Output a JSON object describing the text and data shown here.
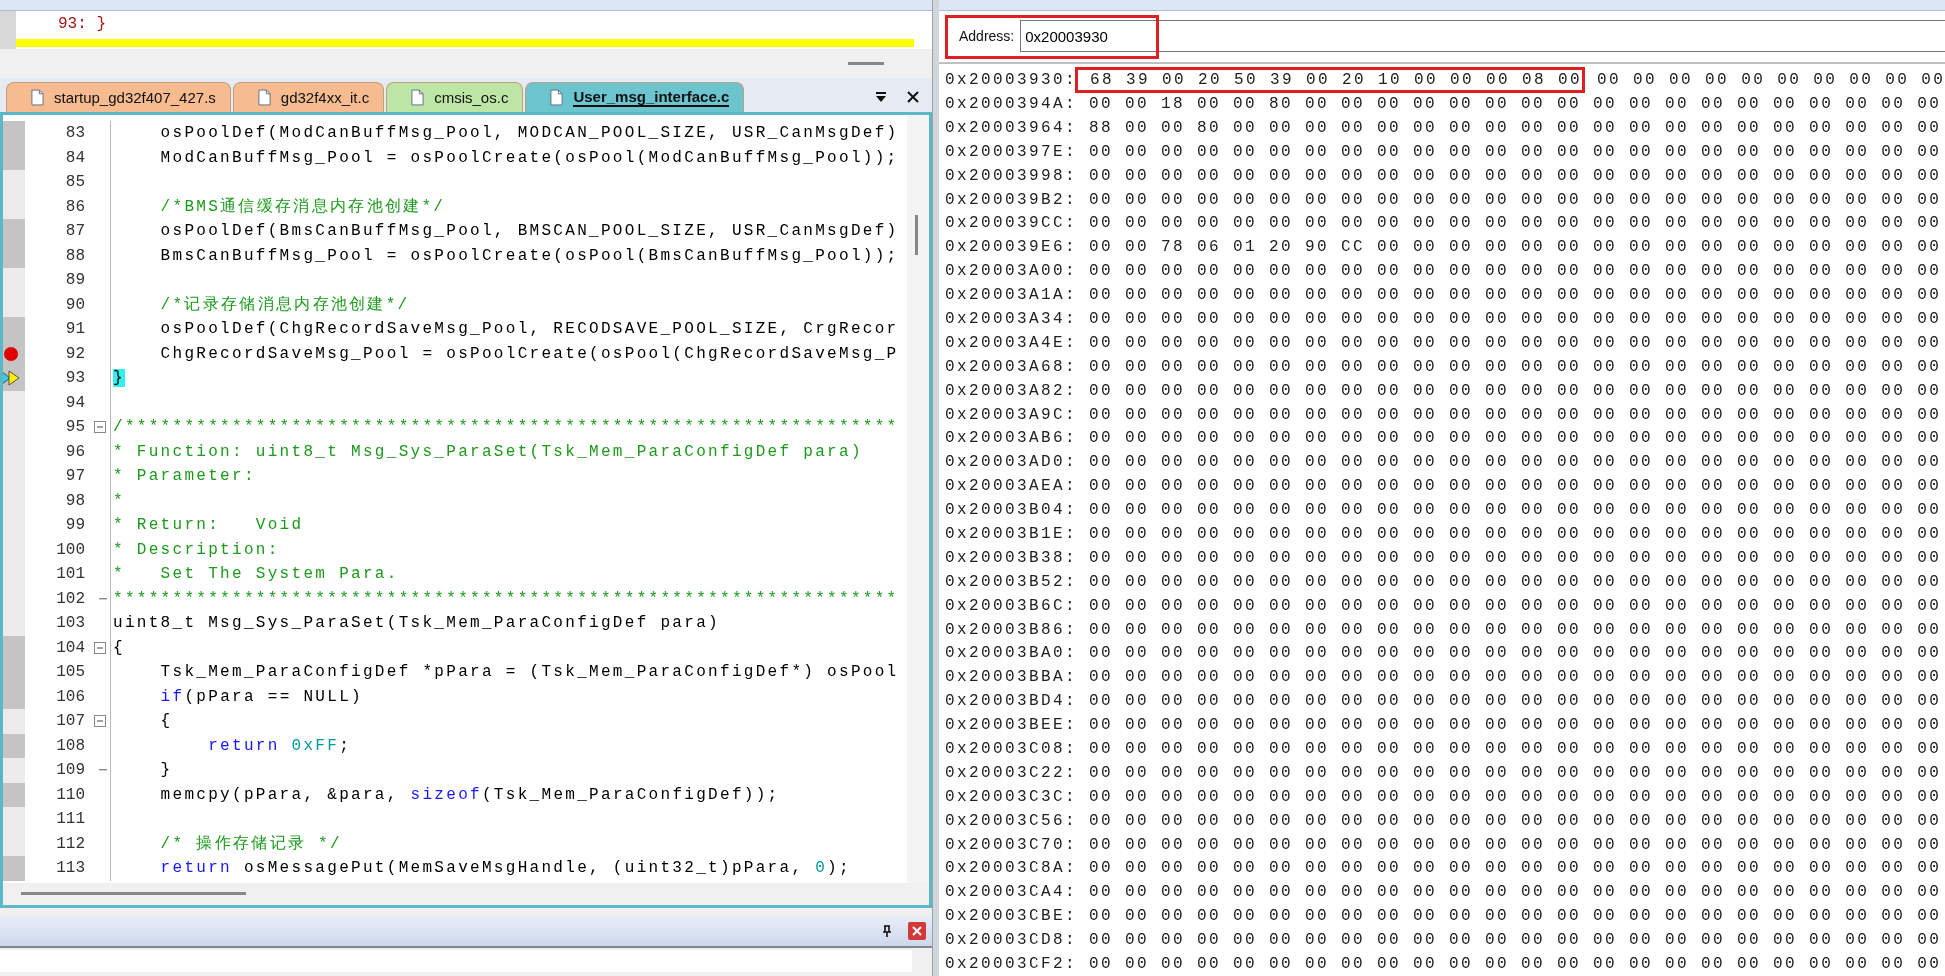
{
  "disassembly": {
    "line": "93: }",
    "current_line": true
  },
  "editor": {
    "tabs": [
      {
        "label": "startup_gd32f407_427.s",
        "selected": false,
        "color": "#f6bb8e"
      },
      {
        "label": "gd32f4xx_it.c",
        "selected": false,
        "color": "#f6bb8e"
      },
      {
        "label": "cmsis_os.c",
        "selected": false,
        "color": "#bde6a4"
      },
      {
        "label": "User_msg_interface.c",
        "selected": true,
        "color": "#6cc4cf"
      }
    ],
    "lines": [
      {
        "number": "83",
        "executable": true,
        "segments": [
          {
            "kind": "plain",
            "text": "    osPoolDef(ModCanBuffMsg_Pool, MODCAN_POOL_SIZE, USR_CanMsgDef)"
          }
        ]
      },
      {
        "number": "84",
        "executable": true,
        "segments": [
          {
            "kind": "plain",
            "text": "    ModCanBuffMsg_Pool = osPoolCreate(osPool(ModCanBuffMsg_Pool));"
          }
        ]
      },
      {
        "number": "85",
        "executable": false
      },
      {
        "number": "86",
        "executable": false,
        "segments": [
          {
            "kind": "comment",
            "text": "    /*BMS通信缓存消息内存池创建*/"
          }
        ]
      },
      {
        "number": "87",
        "executable": true,
        "segments": [
          {
            "kind": "plain",
            "text": "    osPoolDef(BmsCanBuffMsg_Pool, BMSCAN_POOL_SIZE, USR_CanMsgDef)"
          }
        ]
      },
      {
        "number": "88",
        "executable": true,
        "segments": [
          {
            "kind": "plain",
            "text": "    BmsCanBuffMsg_Pool = osPoolCreate(osPool(BmsCanBuffMsg_Pool));"
          }
        ]
      },
      {
        "number": "89",
        "executable": false
      },
      {
        "number": "90",
        "executable": false,
        "segments": [
          {
            "kind": "comment",
            "text": "    /*记录存储消息内存池创建*/"
          }
        ]
      },
      {
        "number": "91",
        "executable": true,
        "segments": [
          {
            "kind": "plain",
            "text": "    osPoolDef(ChgRecordSaveMsg_Pool, RECODSAVE_POOL_SIZE, CrgRecor"
          }
        ]
      },
      {
        "number": "92",
        "executable": true,
        "breakpoint": true,
        "segments": [
          {
            "kind": "plain",
            "text": "    ChgRecordSaveMsg_Pool = osPoolCreate(osPool(ChgRecordSaveMsg_P"
          }
        ]
      },
      {
        "number": "93",
        "executable": true,
        "current": true,
        "segments": [
          {
            "kind": "match",
            "text": "}"
          }
        ]
      },
      {
        "number": "94",
        "executable": false
      },
      {
        "number": "95",
        "executable": false,
        "fold_start": true,
        "segments": [
          {
            "kind": "comment",
            "text": "/*****************************************************************"
          }
        ]
      },
      {
        "number": "96",
        "executable": false,
        "segments": [
          {
            "kind": "comment",
            "text": "* Function: uint8_t Msg_Sys_ParaSet(Tsk_Mem_ParaConfigDef para)"
          }
        ]
      },
      {
        "number": "97",
        "executable": false,
        "segments": [
          {
            "kind": "comment",
            "text": "* Parameter:"
          }
        ]
      },
      {
        "number": "98",
        "executable": false,
        "segments": [
          {
            "kind": "comment",
            "text": "*"
          }
        ]
      },
      {
        "number": "99",
        "executable": false,
        "segments": [
          {
            "kind": "comment",
            "text": "* Return:   Void"
          }
        ]
      },
      {
        "number": "100",
        "executable": false,
        "segments": [
          {
            "kind": "comment",
            "text": "* Description:"
          }
        ]
      },
      {
        "number": "101",
        "executable": false,
        "segments": [
          {
            "kind": "comment",
            "text": "*   Set The System Para."
          }
        ]
      },
      {
        "number": "102",
        "executable": false,
        "fold_end": true,
        "segments": [
          {
            "kind": "comment",
            "text": "******************************************************************"
          }
        ]
      },
      {
        "number": "103",
        "executable": false,
        "segments": [
          {
            "kind": "plain",
            "text": "uint8_t Msg_Sys_ParaSet(Tsk_Mem_ParaConfigDef para)"
          }
        ]
      },
      {
        "number": "104",
        "executable": true,
        "fold_start": true,
        "segments": [
          {
            "kind": "plain",
            "text": "{"
          }
        ]
      },
      {
        "number": "105",
        "executable": true,
        "segments": [
          {
            "kind": "plain",
            "text": "    Tsk_Mem_ParaConfigDef *pPara = (Tsk_Mem_ParaConfigDef*) osPool"
          }
        ]
      },
      {
        "number": "106",
        "executable": true,
        "segments": [
          {
            "kind": "keyword",
            "text": "    if"
          },
          {
            "kind": "plain",
            "text": "(pPara == NULL)"
          }
        ]
      },
      {
        "number": "107",
        "executable": false,
        "fold_start": true,
        "segments": [
          {
            "kind": "plain",
            "text": "    {"
          }
        ]
      },
      {
        "number": "108",
        "executable": true,
        "segments": [
          {
            "kind": "keyword",
            "text": "        return "
          },
          {
            "kind": "number",
            "text": "0xFF"
          },
          {
            "kind": "plain",
            "text": ";"
          }
        ]
      },
      {
        "number": "109",
        "executable": false,
        "fold_end": true,
        "segments": [
          {
            "kind": "plain",
            "text": "    }"
          }
        ]
      },
      {
        "number": "110",
        "executable": true,
        "segments": [
          {
            "kind": "plain",
            "text": "    memcpy(pPara, &para, "
          },
          {
            "kind": "keyword",
            "text": "sizeof"
          },
          {
            "kind": "plain",
            "text": "(Tsk_Mem_ParaConfigDef));"
          }
        ]
      },
      {
        "number": "111",
        "executable": false
      },
      {
        "number": "112",
        "executable": false,
        "segments": [
          {
            "kind": "comment",
            "text": "    /* 操作存储记录 */"
          }
        ]
      },
      {
        "number": "113",
        "executable": true,
        "segments": [
          {
            "kind": "keyword",
            "text": "    return"
          },
          {
            "kind": "plain",
            "text": " osMessagePut(MemSaveMsgHandle, (uint32_t)pPara, "
          },
          {
            "kind": "number",
            "text": "0"
          },
          {
            "kind": "plain",
            "text": ");"
          }
        ]
      }
    ]
  },
  "memory": {
    "address": {
      "label": "Address:",
      "value": "0x20003930",
      "marked": true
    },
    "rows": [
      {
        "address": "0x20003930:",
        "bytes": [
          {
            "text": "68 39 00 20 50 39 00 20 10 00 00 00 08 00",
            "marked": true
          },
          {
            "text": "00 00 00 00 00 00 00 00 00 00",
            "marked": false
          }
        ]
      },
      {
        "address": "0x2000394A:",
        "bytes": [
          {
            "text": "00 00 18 00 00 80 00 00 00 00 00 00 00 00 00 00 00 00 00 00 00 00 00 00",
            "marked": false
          }
        ]
      },
      {
        "address": "0x20003964:",
        "bytes": [
          {
            "text": "88 00 00 80 00 00 00 00 00 00 00 00 00 00 00 00 00 00 00 00 00 00 00 00",
            "marked": false
          }
        ]
      },
      {
        "address": "0x2000397E:",
        "bytes": [
          {
            "text": "00 00 00 00 00 00 00 00 00 00 00 00 00 00 00 00 00 00 00 00 00 00 00 00",
            "marked": false
          }
        ]
      },
      {
        "address": "0x20003998:",
        "bytes": [
          {
            "text": "00 00 00 00 00 00 00 00 00 00 00 00 00 00 00 00 00 00 00 00 00 00 00 00",
            "marked": false
          }
        ]
      },
      {
        "address": "0x200039B2:",
        "bytes": [
          {
            "text": "00 00 00 00 00 00 00 00 00 00 00 00 00 00 00 00 00 00 00 00 00 00 00 00",
            "marked": false
          }
        ]
      },
      {
        "address": "0x200039CC:",
        "bytes": [
          {
            "text": "00 00 00 00 00 00 00 00 00 00 00 00 00 00 00 00 00 00 00 00 00 00 00 00",
            "marked": false
          }
        ]
      },
      {
        "address": "0x200039E6:",
        "bytes": [
          {
            "text": "00 00 78 06 01 20 90 CC 00 00 00 00 00 00 00 00 00 00 00 00 00 00 00 00",
            "marked": false
          }
        ]
      },
      {
        "address": "0x20003A00:",
        "bytes": [
          {
            "text": "00 00 00 00 00 00 00 00 00 00 00 00 00 00 00 00 00 00 00 00 00 00 00 00",
            "marked": false
          }
        ]
      },
      {
        "address": "0x20003A1A:",
        "bytes": [
          {
            "text": "00 00 00 00 00 00 00 00 00 00 00 00 00 00 00 00 00 00 00 00 00 00 00 00",
            "marked": false
          }
        ]
      },
      {
        "address": "0x20003A34:",
        "bytes": [
          {
            "text": "00 00 00 00 00 00 00 00 00 00 00 00 00 00 00 00 00 00 00 00 00 00 00 00",
            "marked": false
          }
        ]
      },
      {
        "address": "0x20003A4E:",
        "bytes": [
          {
            "text": "00 00 00 00 00 00 00 00 00 00 00 00 00 00 00 00 00 00 00 00 00 00 00 00",
            "marked": false
          }
        ]
      },
      {
        "address": "0x20003A68:",
        "bytes": [
          {
            "text": "00 00 00 00 00 00 00 00 00 00 00 00 00 00 00 00 00 00 00 00 00 00 00 00",
            "marked": false
          }
        ]
      },
      {
        "address": "0x20003A82:",
        "bytes": [
          {
            "text": "00 00 00 00 00 00 00 00 00 00 00 00 00 00 00 00 00 00 00 00 00 00 00 00",
            "marked": false
          }
        ]
      },
      {
        "address": "0x20003A9C:",
        "bytes": [
          {
            "text": "00 00 00 00 00 00 00 00 00 00 00 00 00 00 00 00 00 00 00 00 00 00 00 00",
            "marked": false
          }
        ]
      },
      {
        "address": "0x20003AB6:",
        "bytes": [
          {
            "text": "00 00 00 00 00 00 00 00 00 00 00 00 00 00 00 00 00 00 00 00 00 00 00 00",
            "marked": false
          }
        ]
      },
      {
        "address": "0x20003AD0:",
        "bytes": [
          {
            "text": "00 00 00 00 00 00 00 00 00 00 00 00 00 00 00 00 00 00 00 00 00 00 00 00",
            "marked": false
          }
        ]
      },
      {
        "address": "0x20003AEA:",
        "bytes": [
          {
            "text": "00 00 00 00 00 00 00 00 00 00 00 00 00 00 00 00 00 00 00 00 00 00 00 00",
            "marked": false
          }
        ]
      },
      {
        "address": "0x20003B04:",
        "bytes": [
          {
            "text": "00 00 00 00 00 00 00 00 00 00 00 00 00 00 00 00 00 00 00 00 00 00 00 00",
            "marked": false
          }
        ]
      },
      {
        "address": "0x20003B1E:",
        "bytes": [
          {
            "text": "00 00 00 00 00 00 00 00 00 00 00 00 00 00 00 00 00 00 00 00 00 00 00 00",
            "marked": false
          }
        ]
      },
      {
        "address": "0x20003B38:",
        "bytes": [
          {
            "text": "00 00 00 00 00 00 00 00 00 00 00 00 00 00 00 00 00 00 00 00 00 00 00 00",
            "marked": false
          }
        ]
      },
      {
        "address": "0x20003B52:",
        "bytes": [
          {
            "text": "00 00 00 00 00 00 00 00 00 00 00 00 00 00 00 00 00 00 00 00 00 00 00 00",
            "marked": false
          }
        ]
      },
      {
        "address": "0x20003B6C:",
        "bytes": [
          {
            "text": "00 00 00 00 00 00 00 00 00 00 00 00 00 00 00 00 00 00 00 00 00 00 00 00",
            "marked": false
          }
        ]
      },
      {
        "address": "0x20003B86:",
        "bytes": [
          {
            "text": "00 00 00 00 00 00 00 00 00 00 00 00 00 00 00 00 00 00 00 00 00 00 00 00",
            "marked": false
          }
        ]
      },
      {
        "address": "0x20003BA0:",
        "bytes": [
          {
            "text": "00 00 00 00 00 00 00 00 00 00 00 00 00 00 00 00 00 00 00 00 00 00 00 00",
            "marked": false
          }
        ]
      },
      {
        "address": "0x20003BBA:",
        "bytes": [
          {
            "text": "00 00 00 00 00 00 00 00 00 00 00 00 00 00 00 00 00 00 00 00 00 00 00 00",
            "marked": false
          }
        ]
      },
      {
        "address": "0x20003BD4:",
        "bytes": [
          {
            "text": "00 00 00 00 00 00 00 00 00 00 00 00 00 00 00 00 00 00 00 00 00 00 00 00",
            "marked": false
          }
        ]
      },
      {
        "address": "0x20003BEE:",
        "bytes": [
          {
            "text": "00 00 00 00 00 00 00 00 00 00 00 00 00 00 00 00 00 00 00 00 00 00 00 00",
            "marked": false
          }
        ]
      },
      {
        "address": "0x20003C08:",
        "bytes": [
          {
            "text": "00 00 00 00 00 00 00 00 00 00 00 00 00 00 00 00 00 00 00 00 00 00 00 00",
            "marked": false
          }
        ]
      },
      {
        "address": "0x20003C22:",
        "bytes": [
          {
            "text": "00 00 00 00 00 00 00 00 00 00 00 00 00 00 00 00 00 00 00 00 00 00 00 00",
            "marked": false
          }
        ]
      },
      {
        "address": "0x20003C3C:",
        "bytes": [
          {
            "text": "00 00 00 00 00 00 00 00 00 00 00 00 00 00 00 00 00 00 00 00 00 00 00 00",
            "marked": false
          }
        ]
      },
      {
        "address": "0x20003C56:",
        "bytes": [
          {
            "text": "00 00 00 00 00 00 00 00 00 00 00 00 00 00 00 00 00 00 00 00 00 00 00 00",
            "marked": false
          }
        ]
      },
      {
        "address": "0x20003C70:",
        "bytes": [
          {
            "text": "00 00 00 00 00 00 00 00 00 00 00 00 00 00 00 00 00 00 00 00 00 00 00 00",
            "marked": false
          }
        ]
      },
      {
        "address": "0x20003C8A:",
        "bytes": [
          {
            "text": "00 00 00 00 00 00 00 00 00 00 00 00 00 00 00 00 00 00 00 00 00 00 00 00",
            "marked": false
          }
        ]
      },
      {
        "address": "0x20003CA4:",
        "bytes": [
          {
            "text": "00 00 00 00 00 00 00 00 00 00 00 00 00 00 00 00 00 00 00 00 00 00 00 00",
            "marked": false
          }
        ]
      },
      {
        "address": "0x20003CBE:",
        "bytes": [
          {
            "text": "00 00 00 00 00 00 00 00 00 00 00 00 00 00 00 00 00 00 00 00 00 00 00 00",
            "marked": false
          }
        ]
      },
      {
        "address": "0x20003CD8:",
        "bytes": [
          {
            "text": "00 00 00 00 00 00 00 00 00 00 00 00 00 00 00 00 00 00 00 00 00 00 00 00",
            "marked": false
          }
        ]
      },
      {
        "address": "0x20003CF2:",
        "bytes": [
          {
            "text": "00 00 00 00 00 00 00 00 00 00 00 00 00 00 00 00 00 00 00 00 00 00 00 00",
            "marked": false
          }
        ]
      }
    ]
  }
}
